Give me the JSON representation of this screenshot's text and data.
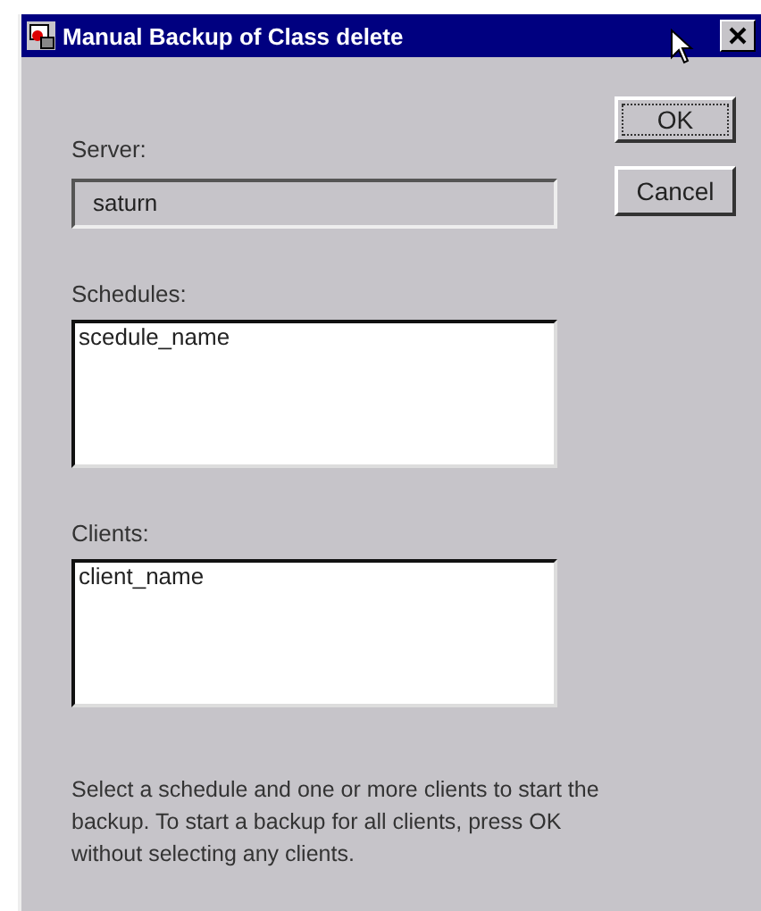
{
  "window": {
    "title": "Manual Backup of Class delete"
  },
  "server": {
    "label": "Server:",
    "value": "saturn"
  },
  "buttons": [
    {
      "label": "OK",
      "default": true
    },
    {
      "label": "Cancel",
      "default": false
    }
  ],
  "schedules": {
    "label": "Schedules:",
    "items": [
      "scedule_name"
    ]
  },
  "clients": {
    "label": "Clients:",
    "items": [
      "client_name"
    ]
  },
  "instructions": "Select a schedule and one or more clients to start the backup. To start a backup for all clients, press OK without selecting any clients."
}
